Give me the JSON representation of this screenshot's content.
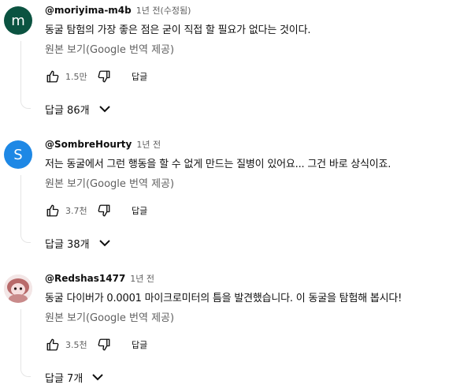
{
  "comments": [
    {
      "author": "@moriyima-m4b",
      "time": "1년 전(수정됨)",
      "avatar_letter": "m",
      "avatar_color": "#0b5341",
      "text": "동굴 탐험의 가장 좋은 점은 굳이 직접 할 필요가 없다는 것이다.",
      "translate_label": "원본 보기(Google 번역 제공)",
      "likes": "1.5만",
      "reply_label": "답글",
      "replies_label": "답글 86개"
    },
    {
      "author": "@SombreHourty",
      "time": "1년 전",
      "avatar_letter": "S",
      "avatar_color": "#1e88e5",
      "text": "저는 동굴에서 그런 행동을 할 수 없게 만드는 질병이 있어요... 그건 바로 상식이죠.",
      "translate_label": "원본 보기(Google 번역 제공)",
      "likes": "3.7천",
      "reply_label": "답글",
      "replies_label": "답글 38개"
    },
    {
      "author": "@Redshas1477",
      "time": "1년 전",
      "avatar_letter": "",
      "avatar_color": "#d9b3b3",
      "text": "동굴 다이버가 0.0001 마이크로미터의 틈을 발견했습니다. 이 동굴을 탐험해 봅시다!",
      "translate_label": "원본 보기(Google 번역 제공)",
      "likes": "3.5천",
      "reply_label": "답글",
      "replies_label": "답글 7개"
    }
  ]
}
